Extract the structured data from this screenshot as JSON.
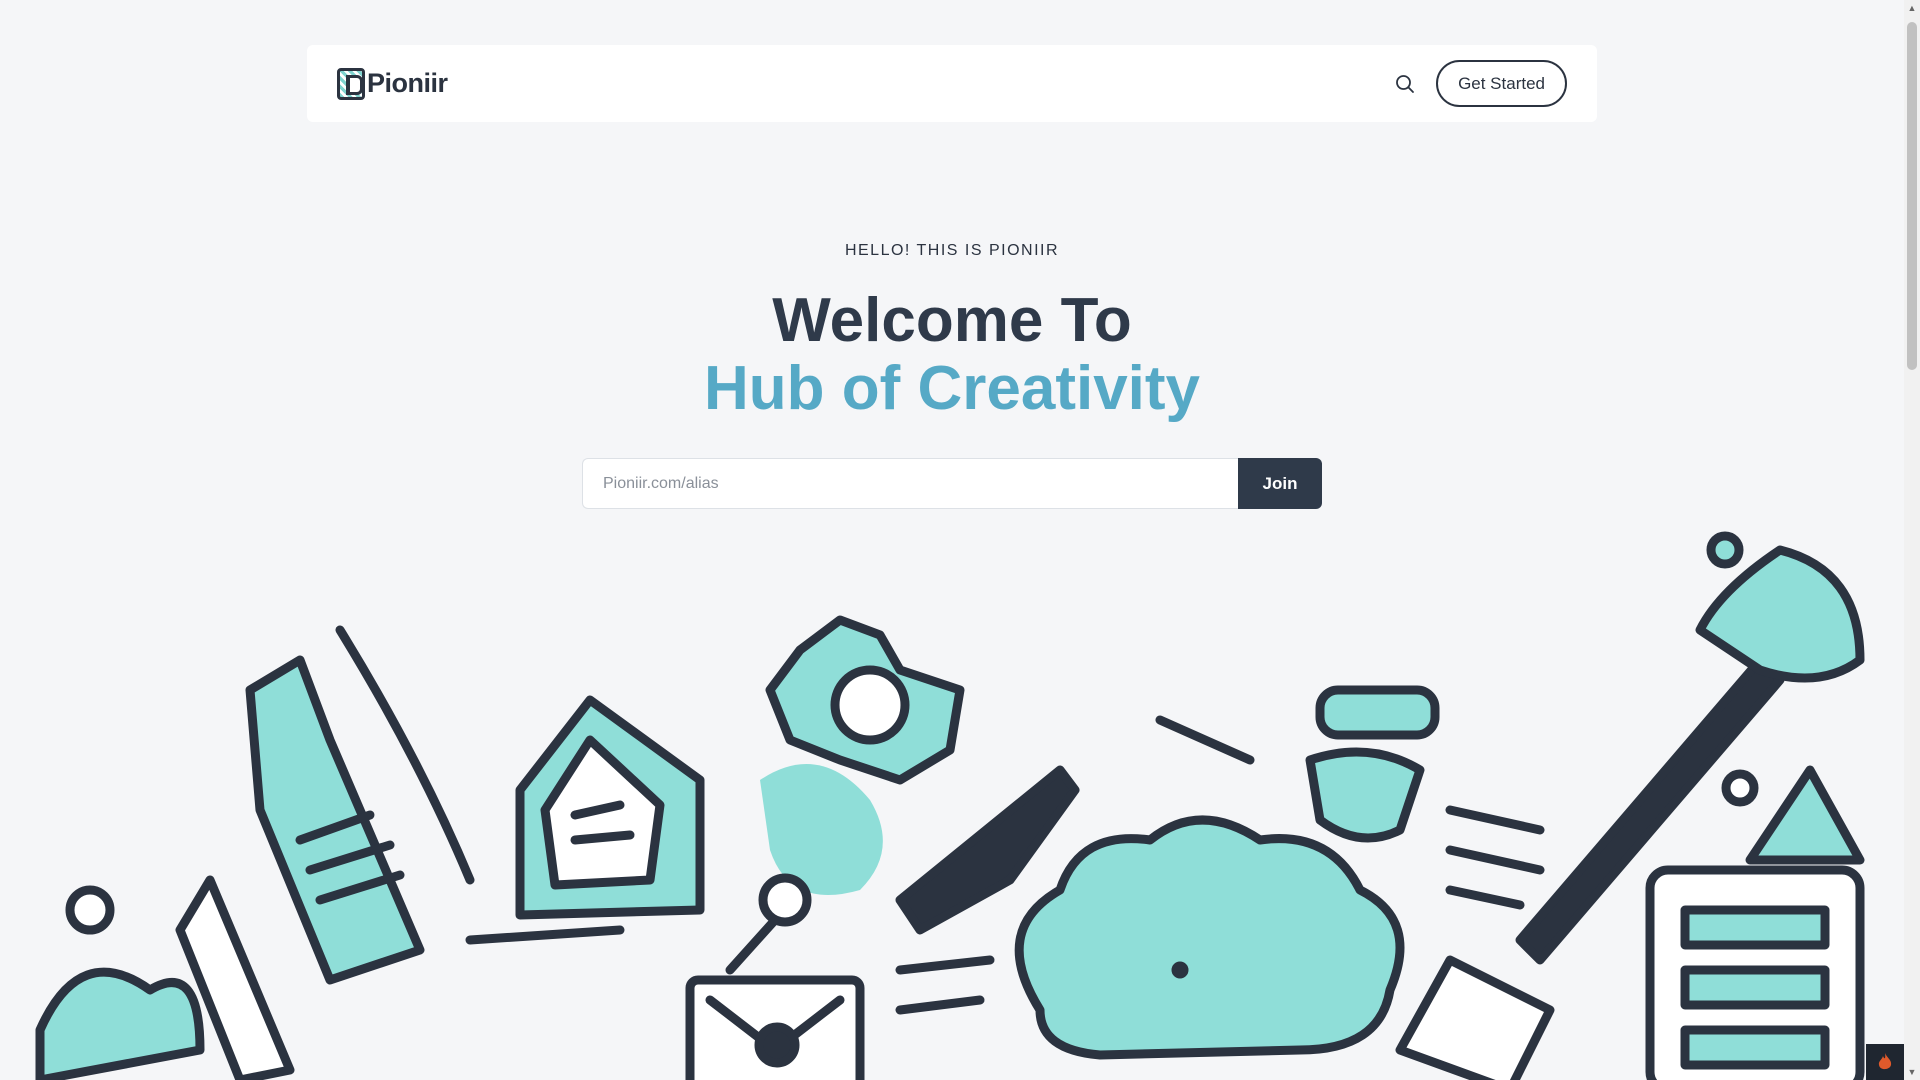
{
  "brand": {
    "name": "Pioniir"
  },
  "nav": {
    "cta_label": "Get Started",
    "search_icon": "search-icon"
  },
  "hero": {
    "eyebrow": "HELLO! THIS IS PIONIIR",
    "title_line1": "Welcome To",
    "title_line2": "Hub of Creativity"
  },
  "join": {
    "placeholder": "Pioniir.com/alias",
    "value": "",
    "button_label": "Join"
  },
  "colors": {
    "accent": "#56a9c6",
    "dark": "#2f3a4a",
    "teal": "#8fded8",
    "background": "#f5f6f8"
  }
}
